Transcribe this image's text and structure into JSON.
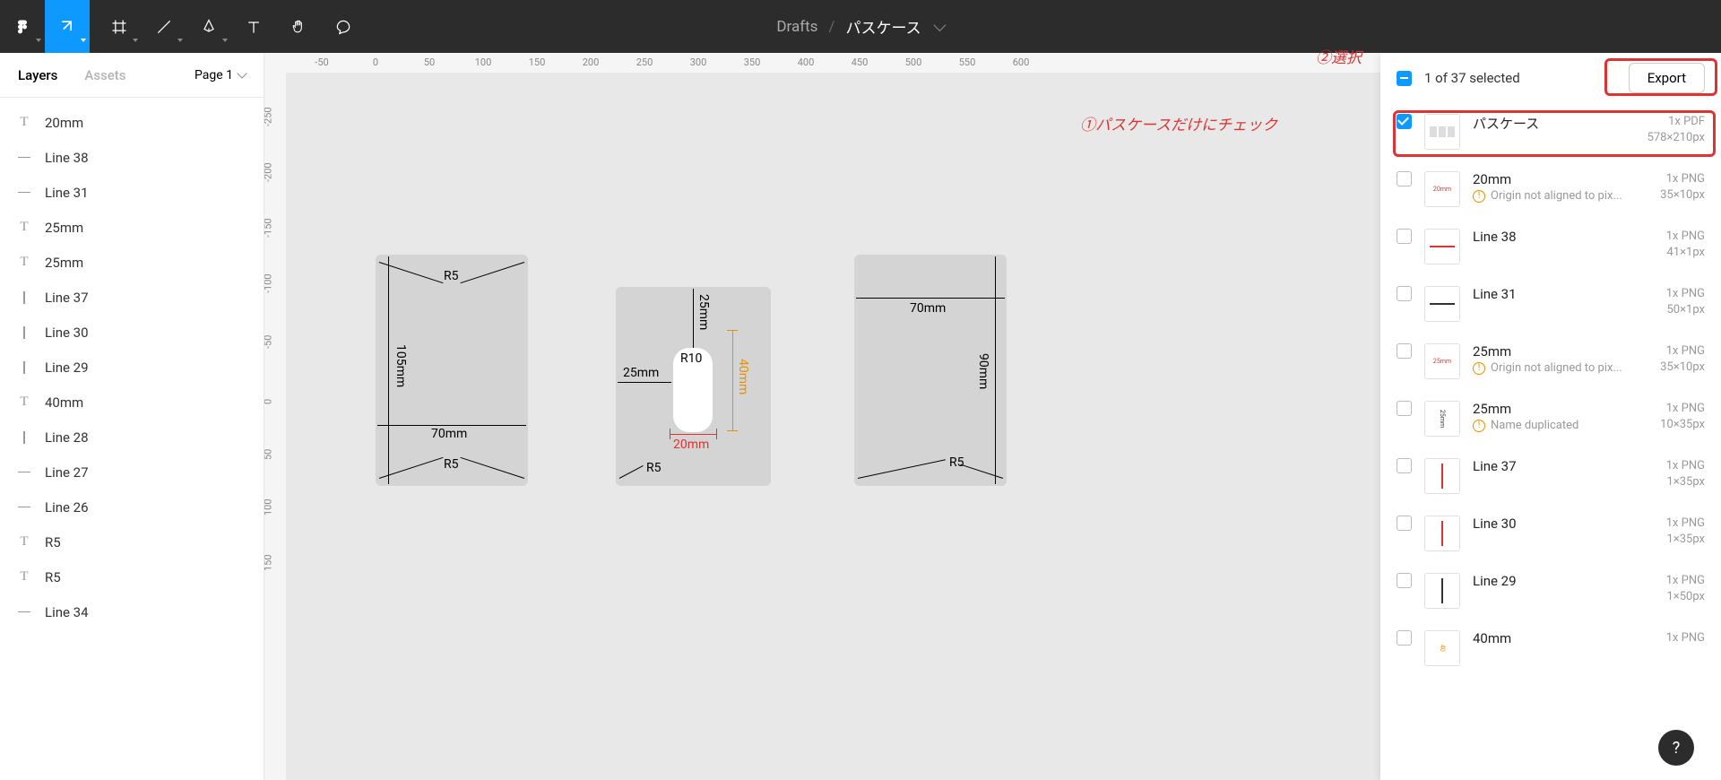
{
  "breadcrumb": {
    "drafts": "Drafts",
    "file": "パスケース"
  },
  "leftPanel": {
    "tabs": {
      "layers": "Layers",
      "assets": "Assets"
    },
    "pageSelector": "Page 1",
    "layers": [
      {
        "icon": "text",
        "label": "20mm"
      },
      {
        "icon": "dash",
        "label": "Line 38"
      },
      {
        "icon": "dash",
        "label": "Line 31"
      },
      {
        "icon": "text",
        "label": "25mm"
      },
      {
        "icon": "text",
        "label": "25mm"
      },
      {
        "icon": "bar",
        "label": "Line 37"
      },
      {
        "icon": "bar",
        "label": "Line 30"
      },
      {
        "icon": "bar",
        "label": "Line 29"
      },
      {
        "icon": "text",
        "label": "40mm"
      },
      {
        "icon": "bar",
        "label": "Line 28"
      },
      {
        "icon": "dash",
        "label": "Line 27"
      },
      {
        "icon": "dash",
        "label": "Line 26"
      },
      {
        "icon": "text",
        "label": "R5"
      },
      {
        "icon": "text",
        "label": "R5"
      },
      {
        "icon": "dash",
        "label": "Line 34"
      }
    ]
  },
  "rulers": {
    "h": [
      "-50",
      "0",
      "50",
      "100",
      "150",
      "200",
      "250",
      "300",
      "350",
      "400",
      "450",
      "500",
      "550",
      "600"
    ],
    "v": [
      "-250",
      "-200",
      "-150",
      "-100",
      "-50",
      "0",
      "50",
      "100",
      "150"
    ]
  },
  "canvas": {
    "frame1": {
      "R5a": "R5",
      "R5b": "R5",
      "v": "105mm",
      "h": "70mm"
    },
    "frame2": {
      "t": "25mm",
      "l": "25mm",
      "r": "40mm",
      "b": "20mm",
      "R5": "R5",
      "R10": "R10"
    },
    "frame3": {
      "t": "70mm",
      "r": "90mm",
      "R5": "R5"
    }
  },
  "exportPanel": {
    "selected": "1 of 37 selected",
    "exportBtn": "Export",
    "items": [
      {
        "checked": true,
        "title": "パスケース",
        "format": "1x PDF",
        "dims": "578×210px",
        "thumb": "frames"
      },
      {
        "checked": false,
        "title": "20mm",
        "format": "1x PNG",
        "dims": "35×10px",
        "thumb": "20mm",
        "warn": "Origin not aligned to pix..."
      },
      {
        "checked": false,
        "title": "Line 38",
        "format": "1x PNG",
        "dims": "41×1px",
        "thumb": "hline-red"
      },
      {
        "checked": false,
        "title": "Line 31",
        "format": "1x PNG",
        "dims": "50×1px",
        "thumb": "hline"
      },
      {
        "checked": false,
        "title": "25mm",
        "format": "1x PNG",
        "dims": "35×10px",
        "thumb": "25mm",
        "warn": "Origin not aligned to pix..."
      },
      {
        "checked": false,
        "title": "25mm",
        "format": "1x PNG",
        "dims": "10×35px",
        "thumb": "v25mm",
        "warn": "Name duplicated"
      },
      {
        "checked": false,
        "title": "Line 37",
        "format": "1x PNG",
        "dims": "1×35px",
        "thumb": "vline-red"
      },
      {
        "checked": false,
        "title": "Line 30",
        "format": "1x PNG",
        "dims": "1×35px",
        "thumb": "vline-red"
      },
      {
        "checked": false,
        "title": "Line 29",
        "format": "1x PNG",
        "dims": "1×50px",
        "thumb": "vline"
      },
      {
        "checked": false,
        "title": "40mm",
        "format": "1x PNG",
        "dims": "",
        "thumb": "40mm-o"
      }
    ]
  },
  "annotations": {
    "a1": "①パスケースだけにチェック",
    "a2": "②選択"
  },
  "help": "?"
}
